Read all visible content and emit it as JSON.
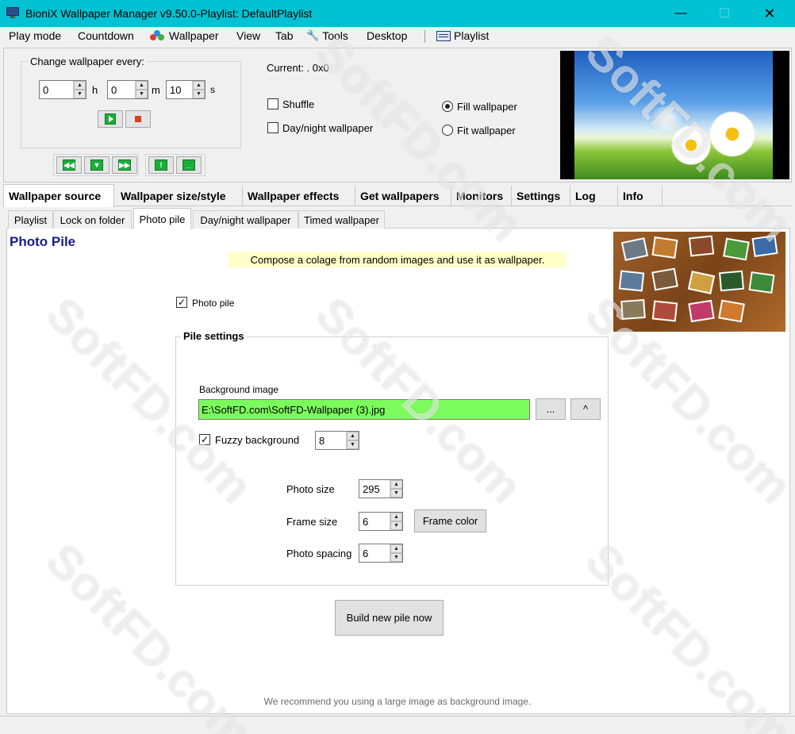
{
  "window": {
    "title": "BioniX Wallpaper Manager  v9.50.0-Playlist: DefaultPlaylist",
    "min": "—",
    "max": "☐",
    "close": "✕"
  },
  "menu": [
    {
      "label": "Play mode"
    },
    {
      "label": "Countdown"
    },
    {
      "label": "Wallpaper",
      "icon": "wallpaper-icon"
    },
    {
      "label": "View"
    },
    {
      "label": "Tab"
    },
    {
      "label": "Tools",
      "icon": "tools-icon"
    },
    {
      "label": "Desktop"
    },
    {
      "label": "Playlist",
      "icon": "playlist-icon"
    }
  ],
  "timer": {
    "label": "Change wallpaper every:",
    "hours": "0",
    "hours_unit": "h",
    "minutes": "0",
    "minutes_unit": "m",
    "seconds": "10",
    "seconds_unit": "s"
  },
  "current": "Current: .  0x0",
  "options": {
    "shuffle": {
      "label": "Shuffle",
      "checked": false
    },
    "daynight": {
      "label": "Day/night wallpaper",
      "checked": false
    },
    "fill": {
      "label": "Fill wallpaper",
      "selected": true
    },
    "fit": {
      "label": "Fit wallpaper",
      "selected": false
    }
  },
  "main_tabs": [
    {
      "label": "Wallpaper source",
      "active": true
    },
    {
      "label": "Wallpaper size/style"
    },
    {
      "label": "Wallpaper effects"
    },
    {
      "label": "Get wallpapers"
    },
    {
      "label": "Monitors"
    },
    {
      "label": "Settings"
    },
    {
      "label": "Log"
    },
    {
      "label": "Info"
    }
  ],
  "sub_tabs": [
    {
      "label": "Playlist"
    },
    {
      "label": "Lock on folder"
    },
    {
      "label": "Photo pile",
      "active": true
    },
    {
      "label": "Day/night wallpaper"
    },
    {
      "label": "Timed wallpaper"
    }
  ],
  "photo_pile": {
    "title": "Photo Pile",
    "hint": "Compose a colage from random images and use it as wallpaper.",
    "enable_label": "Photo pile",
    "enabled": true,
    "group_title": "Pile settings",
    "bg_label": "Background image",
    "bg_value": "E:\\SoftFD.com\\SoftFD-Wallpaper (3).jpg",
    "browse_label": "...",
    "up_label": "^",
    "fuzzy_label": "Fuzzy background",
    "fuzzy_checked": true,
    "fuzzy_value": "8",
    "photo_size_label": "Photo size",
    "photo_size": "295",
    "frame_size_label": "Frame size",
    "frame_size": "6",
    "frame_color_label": "Frame color",
    "spacing_label": "Photo spacing",
    "spacing": "6",
    "build_label": "Build new pile now",
    "recommend": "We recommend you using a large image as background image."
  },
  "watermark": "SoftFD.com",
  "colors": {
    "titlebar": "#00c2d2",
    "bg_field": "#7cfc5c",
    "hint_bg": "#ffffc8",
    "title_blue": "#1a1a8c"
  }
}
